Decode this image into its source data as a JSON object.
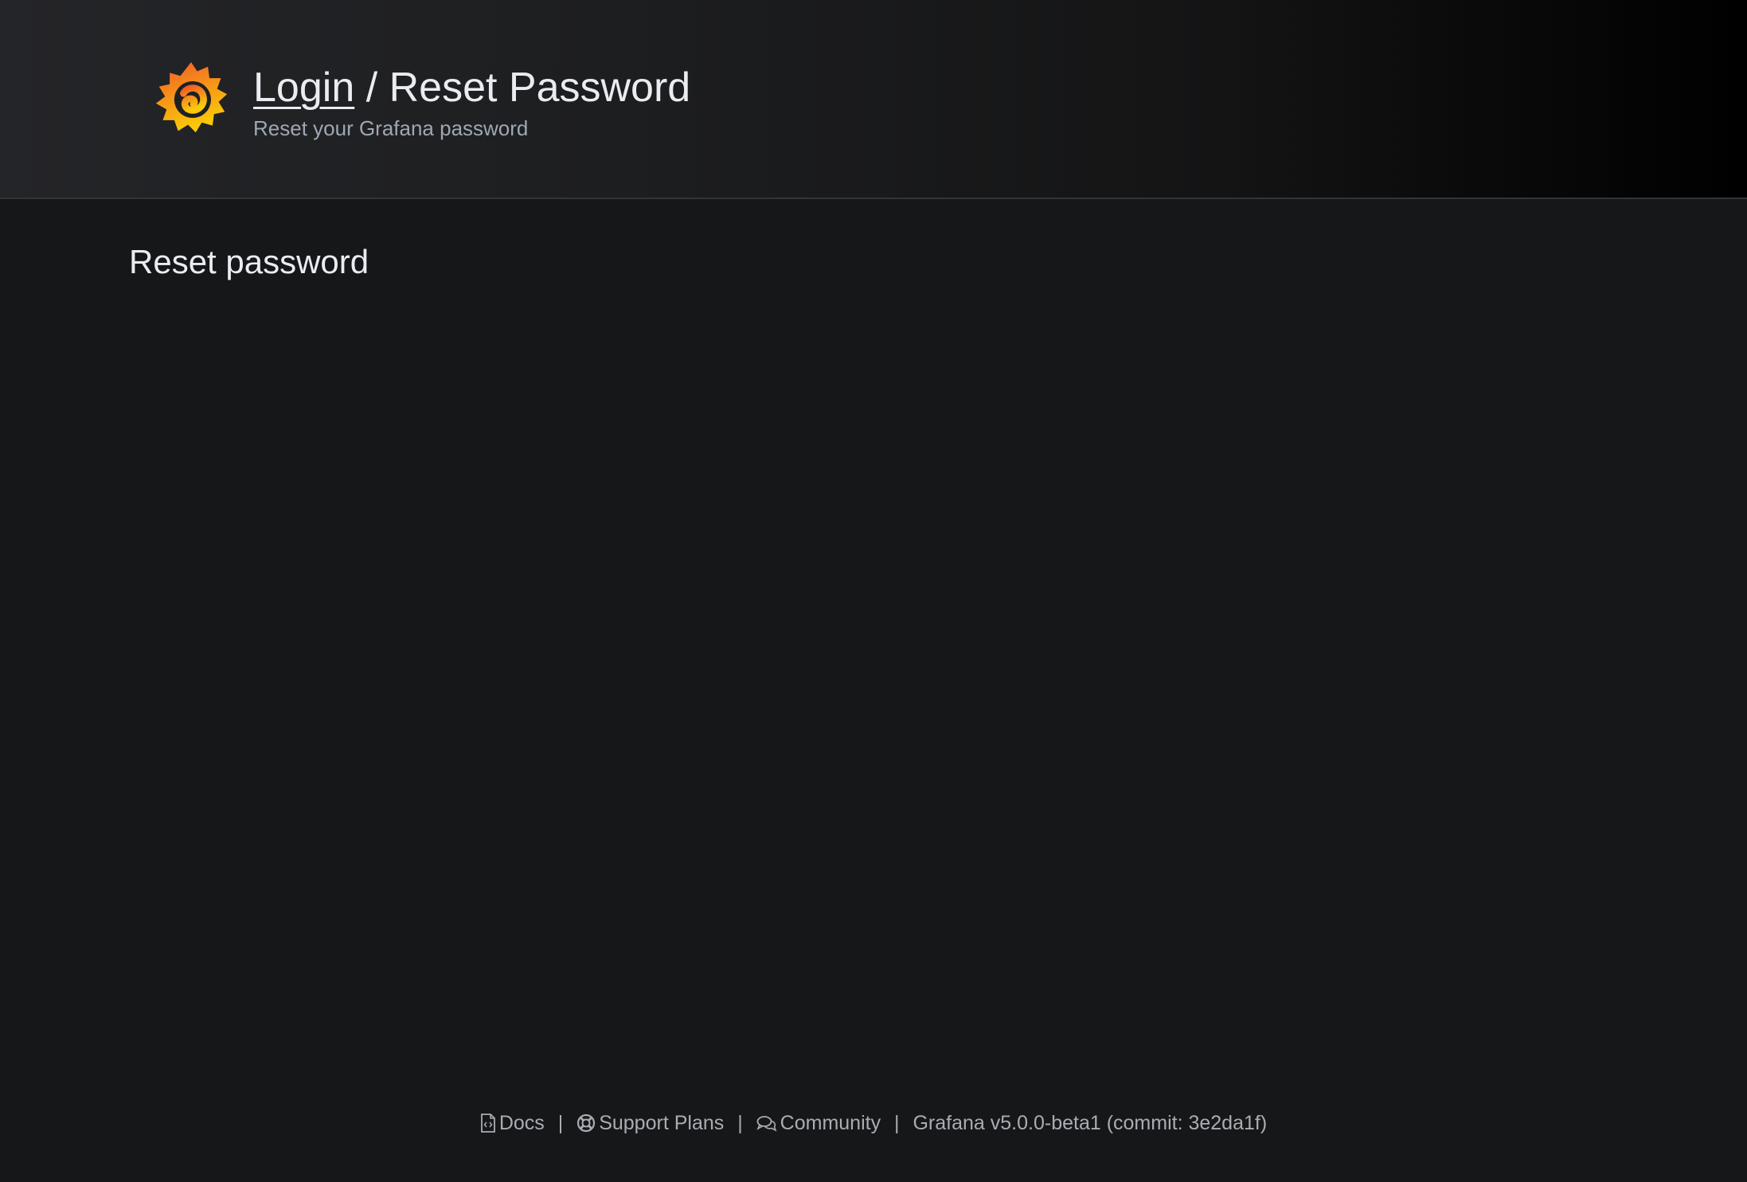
{
  "page": {
    "breadcrumb": {
      "login_label": "Login",
      "separator": "/",
      "current_label": "Reset Password"
    },
    "subtitle": "Reset your Grafana password",
    "section_title": "Reset password"
  },
  "footer": {
    "docs_label": "Docs",
    "support_label": "Support Plans",
    "community_label": "Community",
    "version_label": "Grafana v5.0.0-beta1 (commit: 3e2da1f)",
    "separator": "|"
  },
  "icons": {
    "logo": "grafana-logo-icon",
    "docs": "file-code-icon",
    "support": "life-ring-icon",
    "community": "comments-icon"
  },
  "colors": {
    "background": "#161719",
    "logo_orange": "#f05a28",
    "logo_yellow": "#fbca0a"
  }
}
